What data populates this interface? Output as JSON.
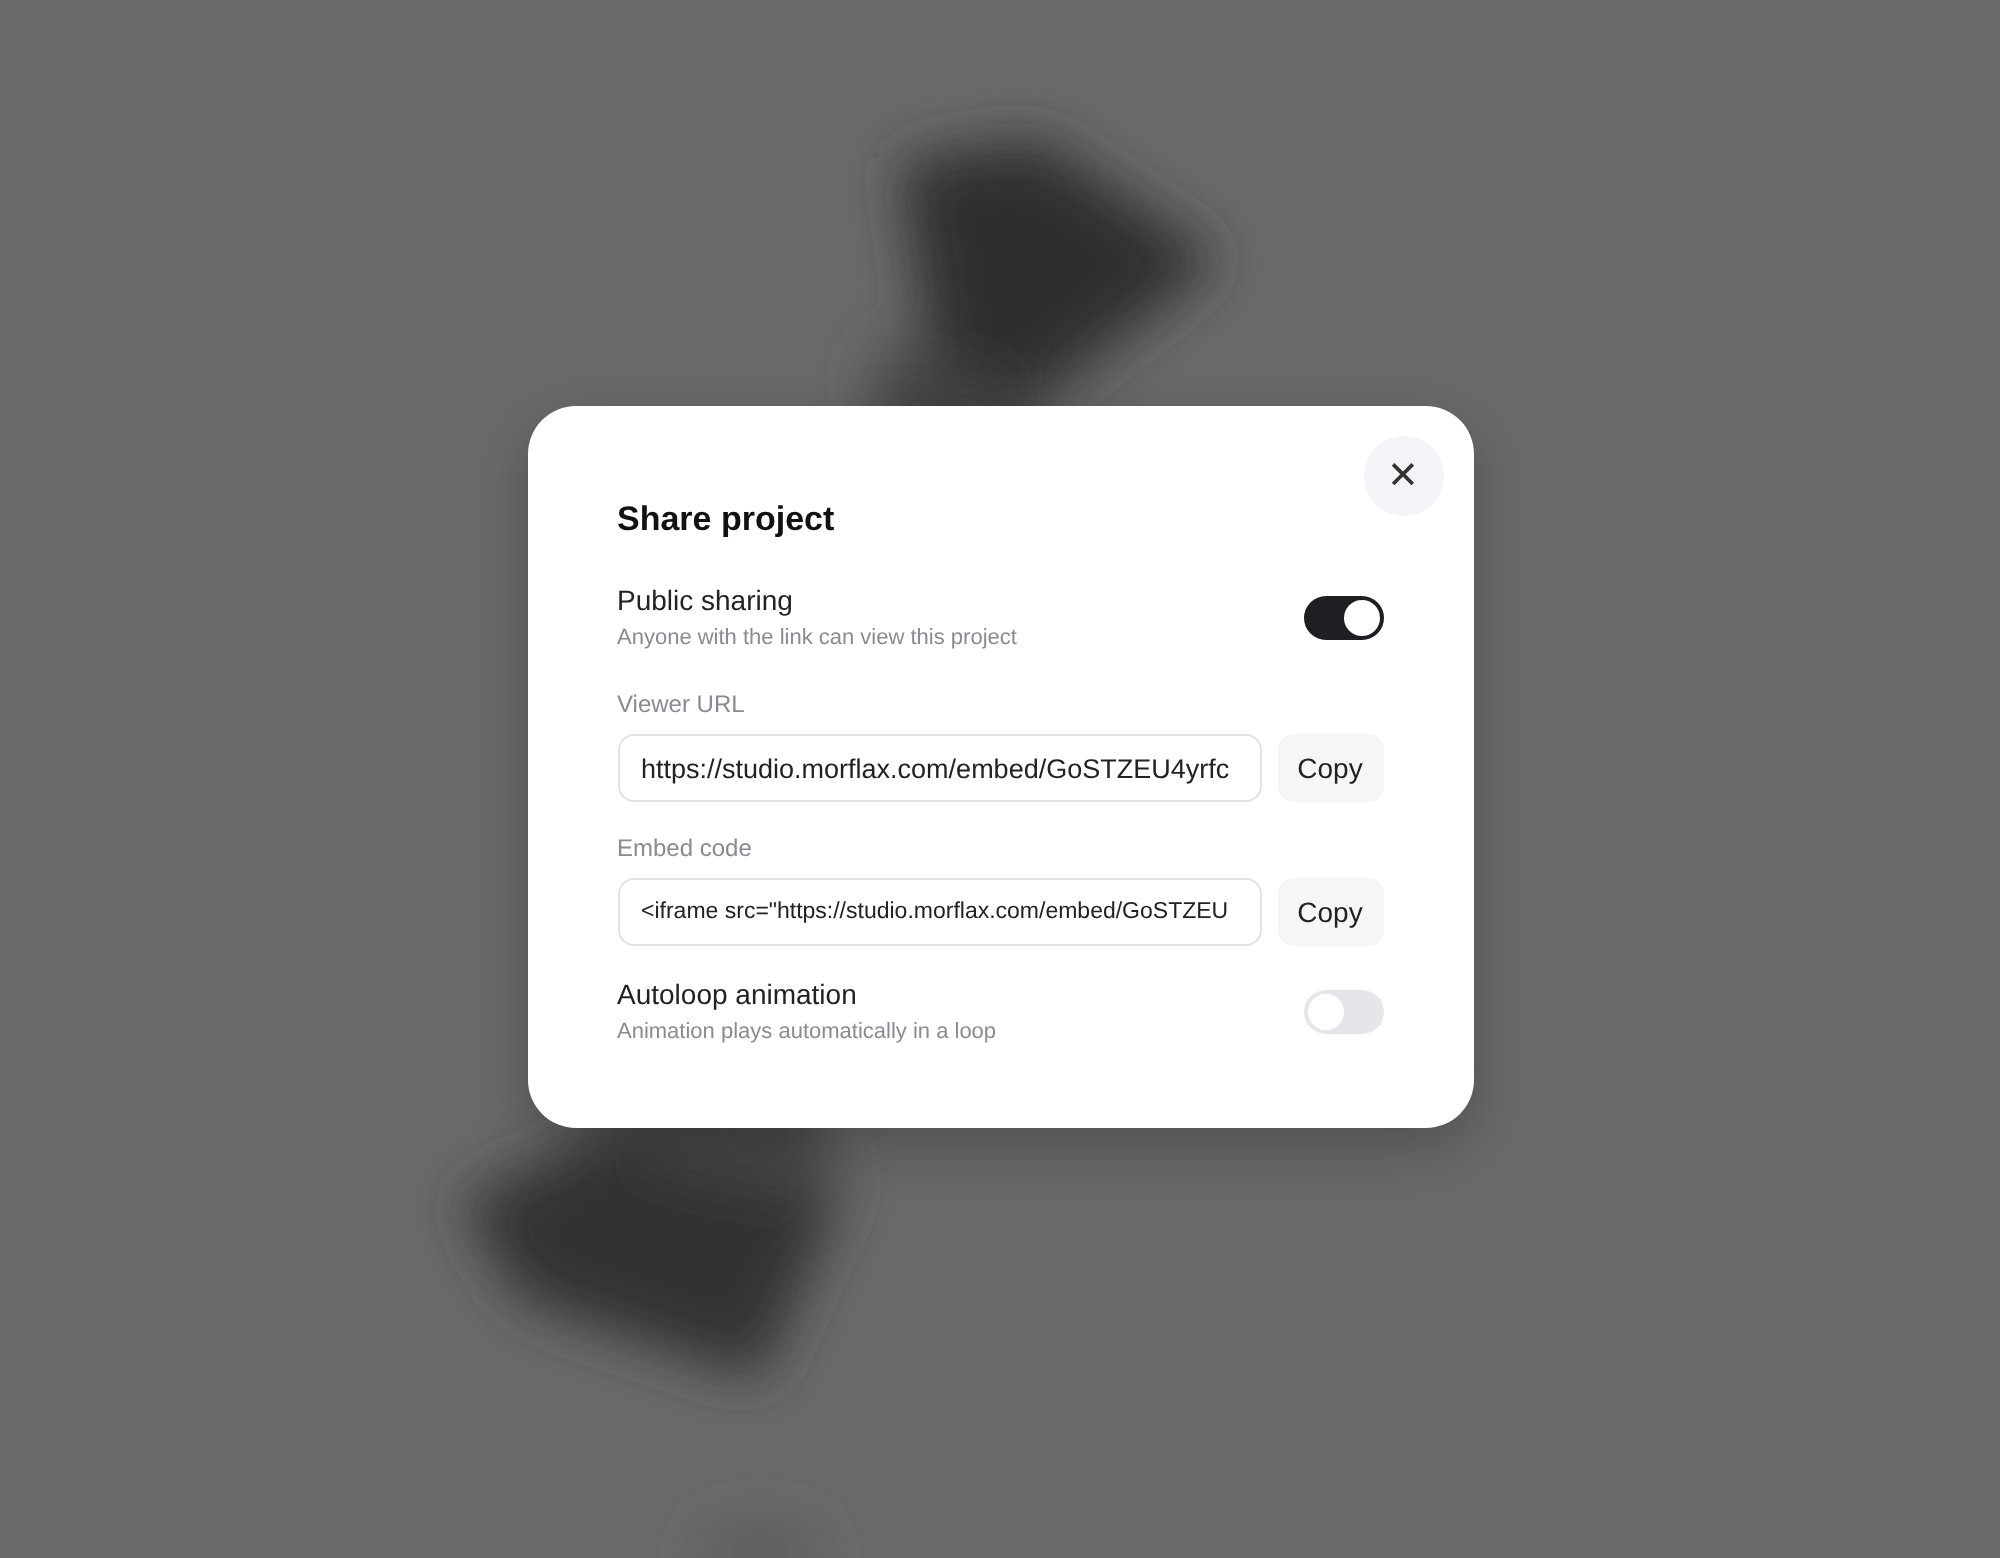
{
  "dialog": {
    "title": "Share project",
    "close": "✕",
    "settings": [
      {
        "kind": "toggle",
        "label": "Public sharing",
        "description": "Anyone with the link can view this project",
        "on": true
      },
      {
        "kind": "field",
        "label": "Viewer URL",
        "value": "https://studio.morflax.com/embed/GoSTZEU4yrfc",
        "button": "Copy",
        "small": false
      },
      {
        "kind": "field",
        "label": "Embed code",
        "value": "<iframe src=\"https://studio.morflax.com/embed/GoSTZEU",
        "button": "Copy",
        "small": true
      },
      {
        "kind": "toggle",
        "label": "Autoloop animation",
        "description": "Animation plays automatically in a loop",
        "on": false
      }
    ]
  }
}
